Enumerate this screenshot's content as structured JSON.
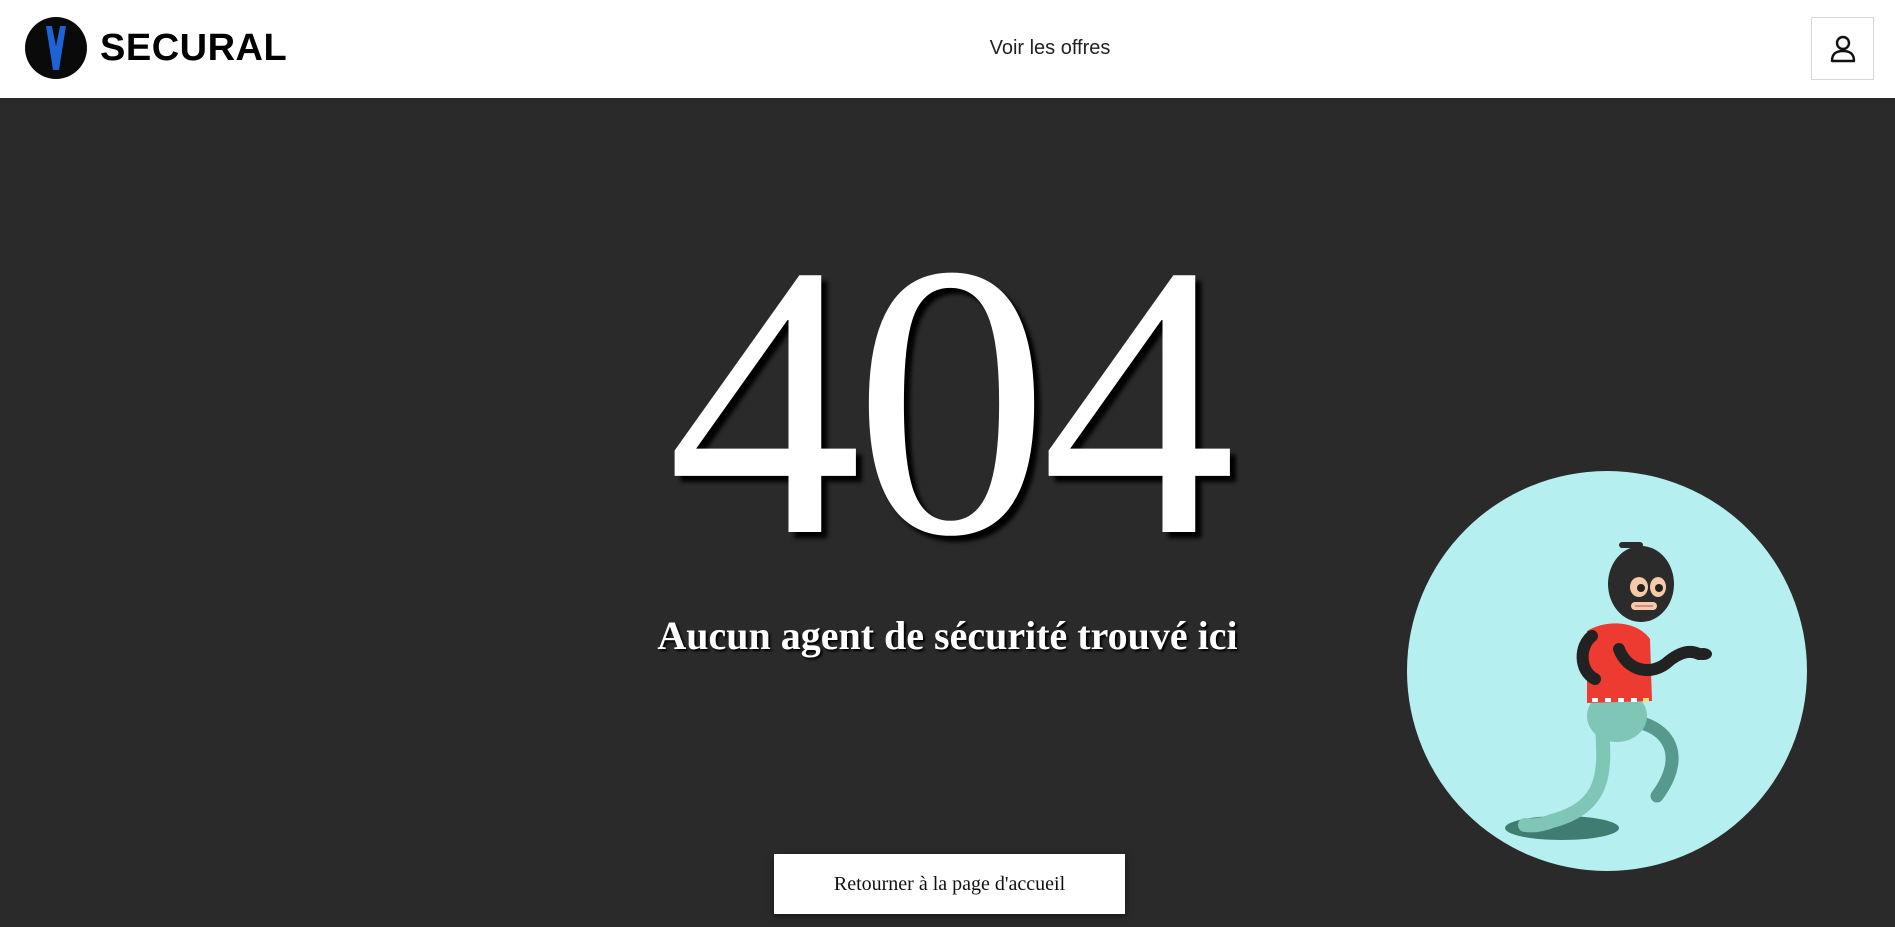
{
  "header": {
    "brand": "SECURAL",
    "logo_icon": "shield-v-logo-icon",
    "nav_link": "Voir les offres",
    "account_icon": "user-icon"
  },
  "main": {
    "error_code": "404",
    "message": "Aucun agent de sécurité trouvé ici",
    "home_button": "Retourner à la page d'accueil",
    "illustration": "burglar-running-illustration"
  },
  "colors": {
    "background": "#2a2a2a",
    "header_bg": "#ffffff",
    "logo_blue": "#1e63d6",
    "illustration_circle": "#b5eff0",
    "burglar_shirt": "#ee3b32",
    "burglar_legs": "#7fc6b6"
  }
}
